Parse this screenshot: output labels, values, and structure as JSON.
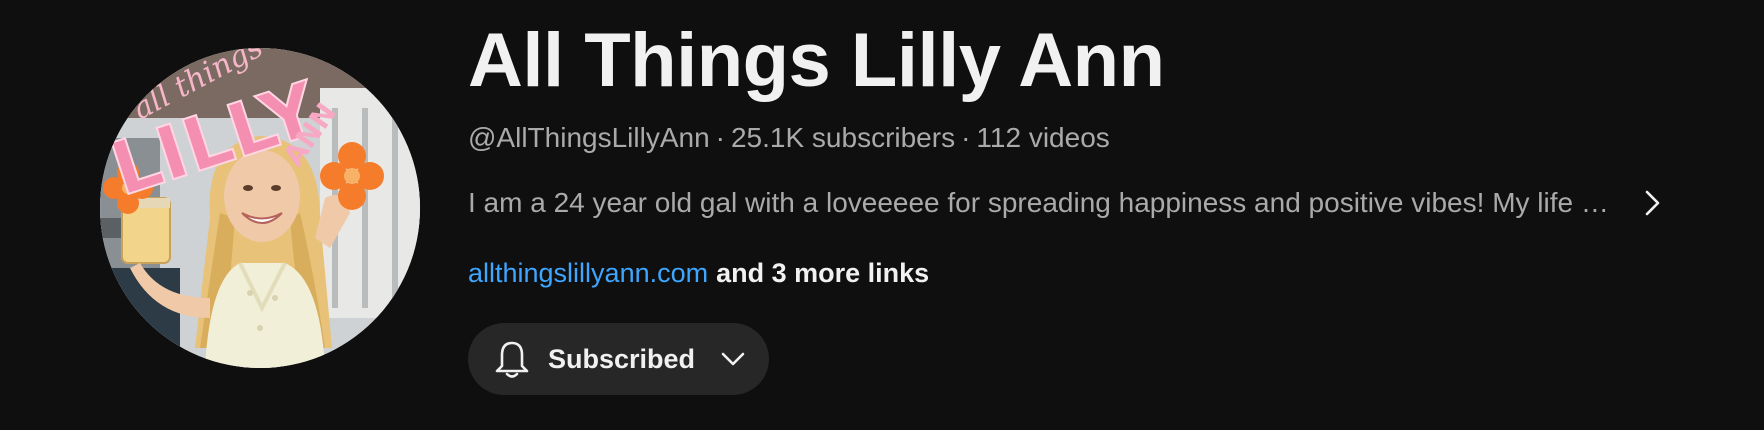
{
  "channel": {
    "name": "All Things Lilly Ann",
    "handle": "@AllThingsLillyAnn",
    "subscribers": "25.1K subscribers",
    "videos": "112 videos",
    "separator": "·",
    "description": "I am a 24 year old gal with a loveeeee for spreading happiness and positive vibes! My life travels, fashion and more",
    "link_text": "allthingslillyann.com",
    "more_links": "and 3 more links"
  },
  "subscribe_button": {
    "label": "Subscribed",
    "icon": "bell-icon",
    "dropdown_icon": "chevron-down-icon"
  },
  "description_expand_icon": "chevron-right-icon",
  "avatar": {
    "logo_text_top": "all things",
    "logo_text_main": "LILLY",
    "logo_text_side": "ANN"
  },
  "colors": {
    "background": "#0f0f0f",
    "title": "#f1f1f1",
    "secondary_text": "#aaaaaa",
    "link": "#3ea6ff",
    "button_bg": "#272727",
    "logo_pink": "#f48fb1",
    "logo_orange": "#f57c2a"
  }
}
